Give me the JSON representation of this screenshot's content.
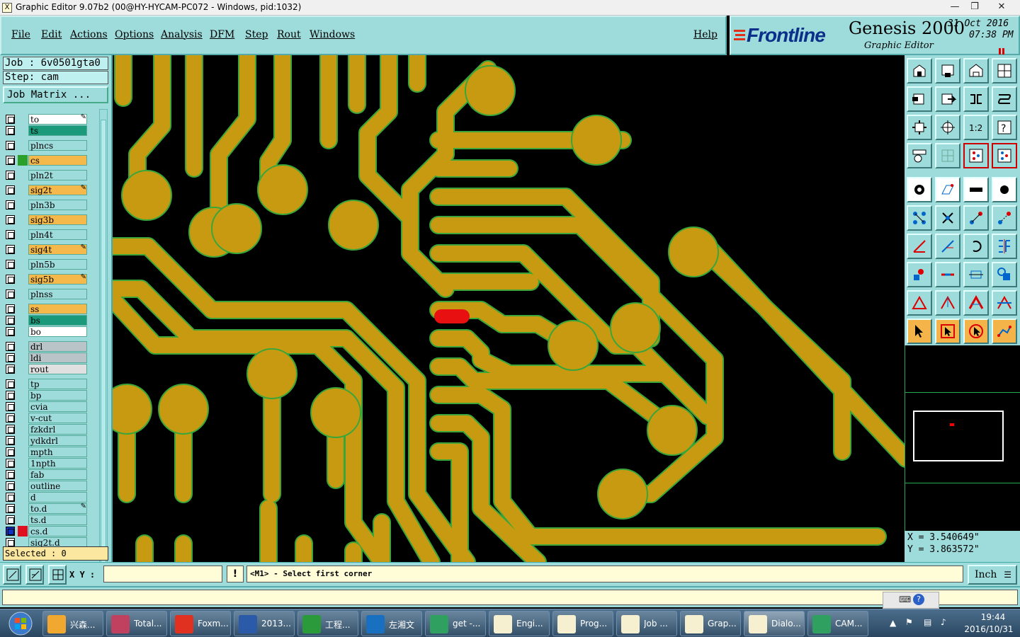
{
  "window": {
    "title": "Graphic Editor 9.07b2 (00@HY-HYCAM-PC072 - Windows, pid:1032)",
    "app_icon": "X",
    "controls": {
      "minimize": "—",
      "maximize": "❐",
      "close": "✕"
    }
  },
  "menu": {
    "items": [
      "File",
      "Edit",
      "Actions",
      "Options",
      "Analysis",
      "DFM",
      "Step",
      "Rout",
      "Windows"
    ],
    "help": "Help"
  },
  "brand": {
    "logo": "Frontline",
    "product": "Genesis 2000",
    "subtitle": "Graphic Editor",
    "date": "31 Oct 2016",
    "time": "07:38 PM"
  },
  "job": {
    "job_line": "Job : 6v0501gta0",
    "step_line": "Step: cam",
    "matrix_button": "Job Matrix ...",
    "selected": "Selected : 0"
  },
  "layers": [
    {
      "name": "to",
      "color": "#ffffff",
      "swatch": "",
      "locked": true
    },
    {
      "name": "ts",
      "color": "#1a9a7a",
      "swatch": "",
      "locked": false
    },
    {
      "name": "plncs",
      "color": "#9edcdc",
      "swatch": "",
      "locked": false
    },
    {
      "name": "cs",
      "color": "#f5b84a",
      "swatch": "#2aa02a",
      "locked": false
    },
    {
      "name": "pln2t",
      "color": "#9edcdc",
      "swatch": "",
      "locked": false
    },
    {
      "name": "sig2t",
      "color": "#f5b84a",
      "swatch": "",
      "locked": true
    },
    {
      "name": "pln3b",
      "color": "#9edcdc",
      "swatch": "",
      "locked": false
    },
    {
      "name": "sig3b",
      "color": "#f5b84a",
      "swatch": "",
      "locked": false
    },
    {
      "name": "pln4t",
      "color": "#9edcdc",
      "swatch": "",
      "locked": false
    },
    {
      "name": "sig4t",
      "color": "#f5b84a",
      "swatch": "",
      "locked": true
    },
    {
      "name": "pln5b",
      "color": "#9edcdc",
      "swatch": "",
      "locked": false
    },
    {
      "name": "sig5b",
      "color": "#f5b84a",
      "swatch": "",
      "locked": true
    },
    {
      "name": "plnss",
      "color": "#9edcdc",
      "swatch": "",
      "locked": false
    },
    {
      "name": "ss",
      "color": "#f5b84a",
      "swatch": "",
      "locked": false
    },
    {
      "name": "bs",
      "color": "#1a9a7a",
      "swatch": "",
      "locked": false
    },
    {
      "name": "bo",
      "color": "#ffffff",
      "swatch": "",
      "locked": false
    },
    {
      "name": "drl",
      "color": "#b8c4c8",
      "swatch": "",
      "locked": false
    },
    {
      "name": "ldi",
      "color": "#b8c4c8",
      "swatch": "",
      "locked": false
    },
    {
      "name": "rout",
      "color": "#e0e0e0",
      "swatch": "",
      "locked": false
    },
    {
      "name": "tp",
      "color": "#9edcdc",
      "swatch": "",
      "locked": false
    },
    {
      "name": "bp",
      "color": "#9edcdc",
      "swatch": "",
      "locked": false
    },
    {
      "name": "cvia",
      "color": "#9edcdc",
      "swatch": "",
      "locked": false
    },
    {
      "name": "v-cut",
      "color": "#9edcdc",
      "swatch": "",
      "locked": false
    },
    {
      "name": "fzkdrl",
      "color": "#9edcdc",
      "swatch": "",
      "locked": false
    },
    {
      "name": "ydkdrl",
      "color": "#9edcdc",
      "swatch": "",
      "locked": false
    },
    {
      "name": "mpth",
      "color": "#9edcdc",
      "swatch": "",
      "locked": false
    },
    {
      "name": "1npth",
      "color": "#9edcdc",
      "swatch": "",
      "locked": false
    },
    {
      "name": "fab",
      "color": "#9edcdc",
      "swatch": "",
      "locked": false
    },
    {
      "name": "outline",
      "color": "#9edcdc",
      "swatch": "",
      "locked": false
    },
    {
      "name": "d",
      "color": "#9edcdc",
      "swatch": "",
      "locked": false
    },
    {
      "name": "to.d",
      "color": "#9edcdc",
      "swatch": "",
      "locked": true
    },
    {
      "name": "ts.d",
      "color": "#9edcdc",
      "swatch": "",
      "locked": false
    },
    {
      "name": "cs.d",
      "color": "#9edcdc",
      "swatch": "#e01020",
      "locked": false,
      "checked": true
    },
    {
      "name": "sig2t.d",
      "color": "#9edcdc",
      "swatch": "",
      "locked": false
    }
  ],
  "layer_groups_gap_after": [
    "ts",
    "plnss",
    "bo",
    "rout"
  ],
  "colors": {
    "copper": "#c89a12",
    "copper_edge": "#3aa63a",
    "highlight": "#e81010",
    "panel": "#9edcdc"
  },
  "tools": [
    "home-icon",
    "save-icon",
    "house-icon",
    "window-icon",
    "zoom-out-icon",
    "zoom-in-icon",
    "pan-icon",
    "flip-icon",
    "fit-icon",
    "center-icon",
    "ratio-icon",
    "help-icon",
    "measure-icon",
    "grid-icon",
    "layers-icon",
    "layers2-icon",
    "snap-icon",
    "draw-icon",
    "ruler-icon",
    "pad-icon",
    "node-icon",
    "cross-icon",
    "move-icon",
    "copy-icon",
    "line-icon",
    "line2-icon",
    "undo-icon",
    "mirror-icon",
    "poly-icon",
    "minus-icon",
    "resize-icon",
    "shapes-icon",
    "tri-icon",
    "tri2-icon",
    "tri3-icon",
    "tri4-icon",
    "pointer-icon",
    "select-icon",
    "select2-icon",
    "route-icon"
  ],
  "ratio_label": "1:2",
  "coords": {
    "x": "X = 3.540649\"",
    "y": "Y = 3.863572\""
  },
  "command": {
    "xy_label": "X Y :",
    "xy_value": "",
    "warn": "!",
    "prompt": "<M1> - Select first corner",
    "unit": "Inch"
  },
  "taskbar": {
    "tasks": [
      {
        "label": "兴森...",
        "color": "#f0a830"
      },
      {
        "label": "Total...",
        "color": "#c04060"
      },
      {
        "label": "Foxm...",
        "color": "#e03020"
      },
      {
        "label": "2013...",
        "color": "#2a5aa8"
      },
      {
        "label": "工程...",
        "color": "#2a9a3a"
      },
      {
        "label": "左湘文",
        "color": "#1a70c0"
      },
      {
        "label": "get -...",
        "color": "#30a060"
      },
      {
        "label": "Engi...",
        "color": "#f6f0d0"
      },
      {
        "label": "Prog...",
        "color": "#f6f0d0"
      },
      {
        "label": "Job ...",
        "color": "#f6f0d0"
      },
      {
        "label": "Grap...",
        "color": "#f6f0d0"
      },
      {
        "label": "Dialo...",
        "color": "#f6f0d0"
      },
      {
        "label": "CAM...",
        "color": "#30a060"
      }
    ],
    "clock_time": "19:44",
    "clock_date": "2016/10/31"
  }
}
